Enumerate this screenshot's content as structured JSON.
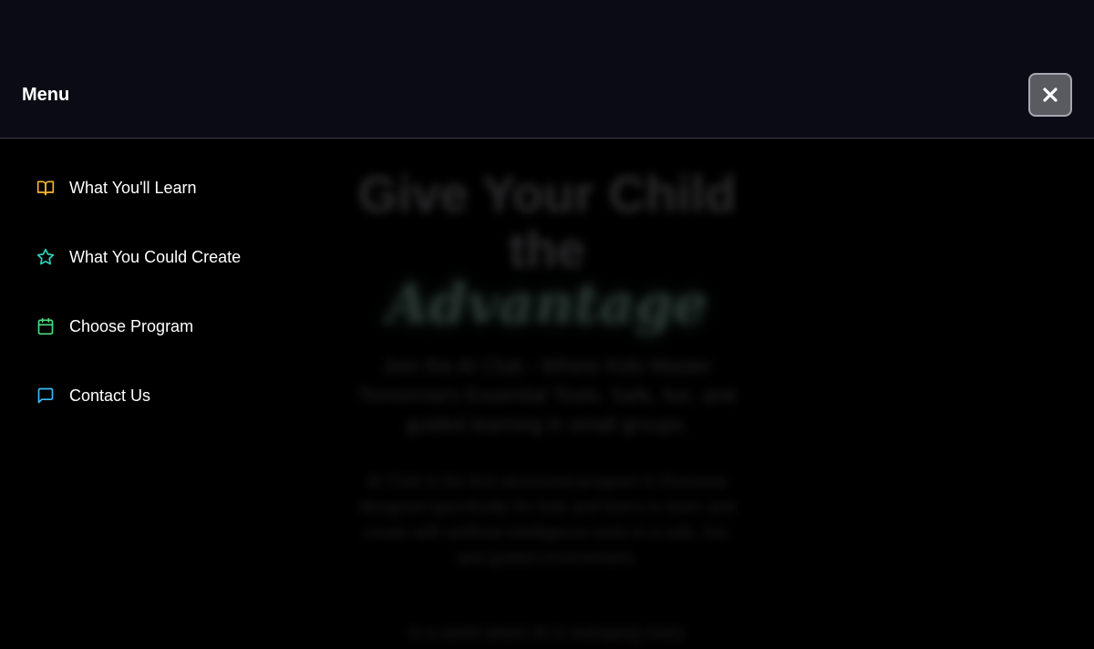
{
  "menu": {
    "title": "Menu",
    "close_icon": "close-icon",
    "items": [
      {
        "label": "What You'll Learn",
        "icon": "book-open-icon",
        "color": "#f5b731"
      },
      {
        "label": "What You Could Create",
        "icon": "star-icon",
        "color": "#2dd4bf"
      },
      {
        "label": "Choose Program",
        "icon": "calendar-icon",
        "color": "#4ade80"
      },
      {
        "label": "Contact Us",
        "icon": "message-square-icon",
        "color": "#38bdf8"
      }
    ]
  },
  "background_hero": {
    "title_line_1": "Give Your Child",
    "title_line_2": "the",
    "title_accent": "Advantage",
    "subtitle": "Join the AI Club - Where Kids Master Tomorrow's Essential Tools. Safe, fun, and guided learning in small groups.",
    "paragraph_1": "AI Club is the first structured program in Romania designed specifically for kids and teens to learn and create with artificial intelligence tools in a safe, fun, and guided environment.",
    "paragraph_2": "In a world where AI is reshaping every"
  }
}
